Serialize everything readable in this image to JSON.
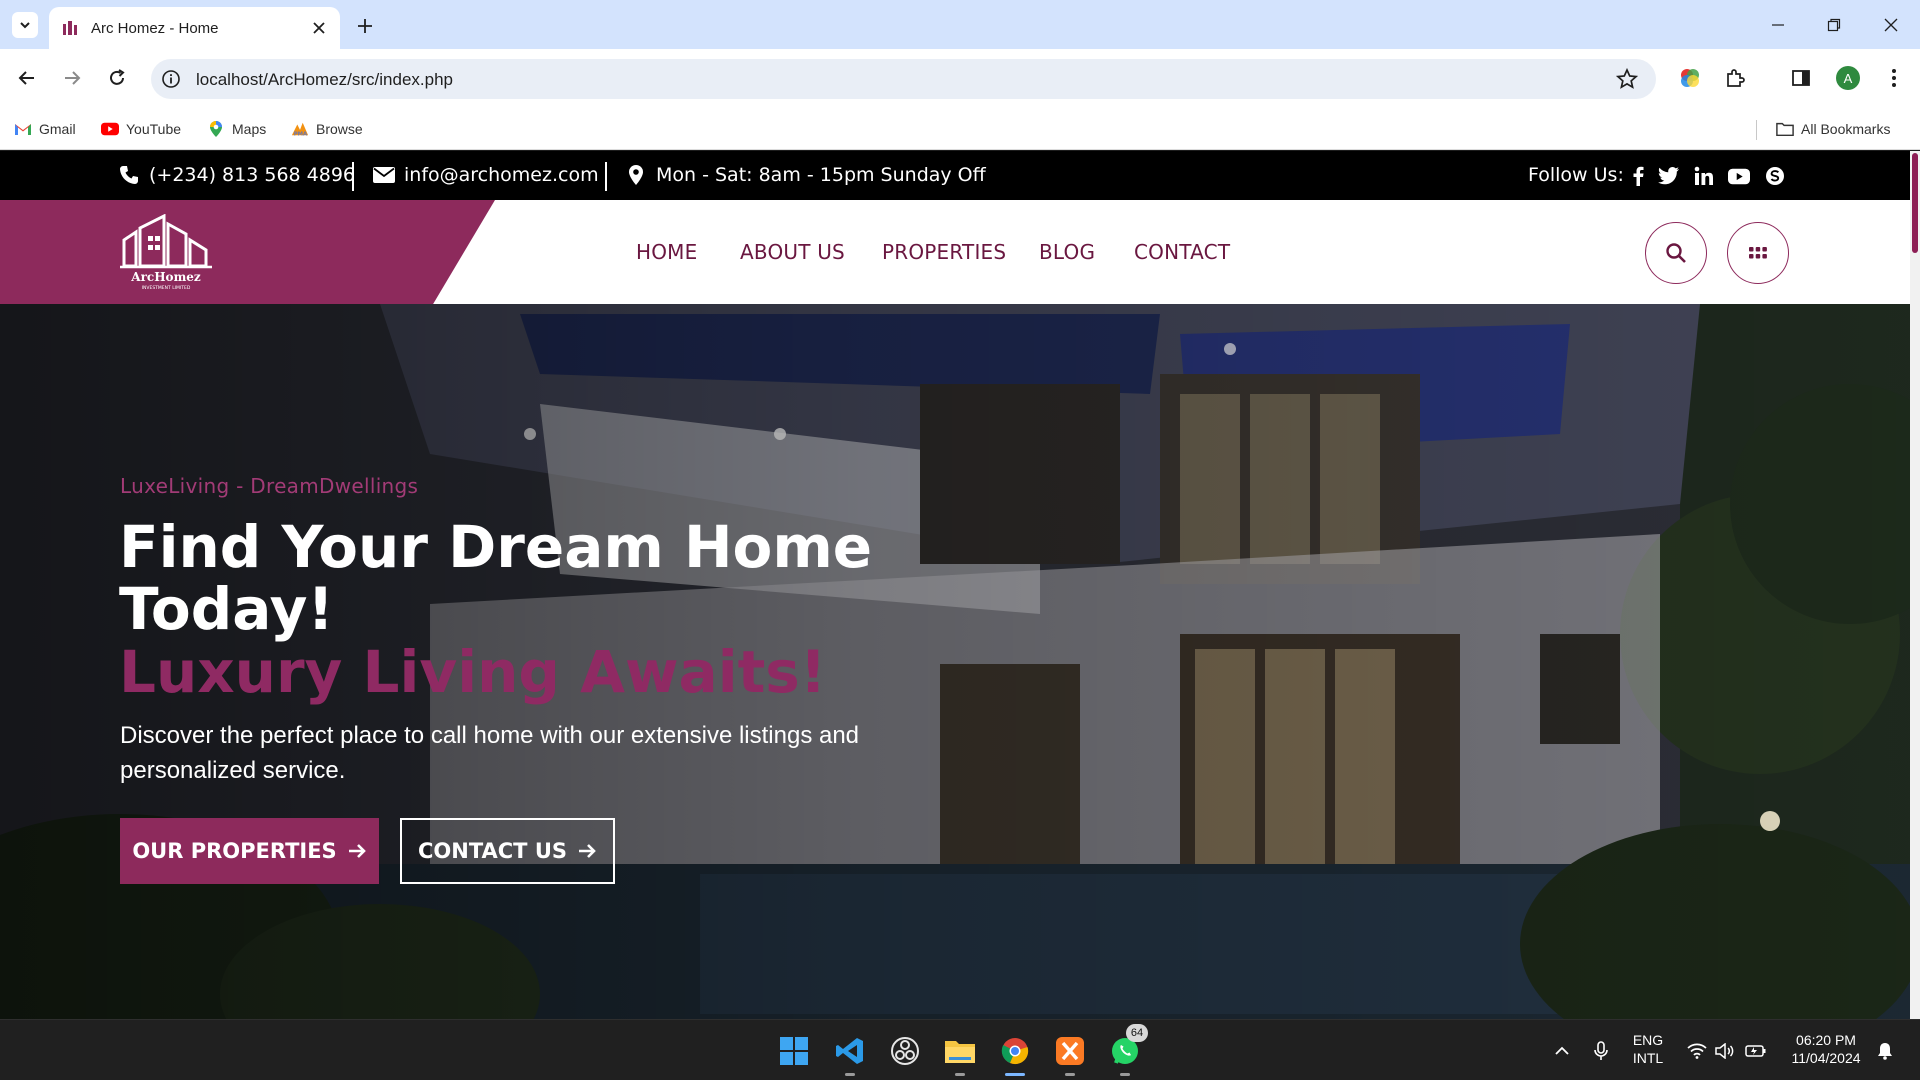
{
  "browser": {
    "tab_title": "Arc Homez - Home",
    "url": "localhost/ArcHomez/src/index.php",
    "profile_initial": "A",
    "bookmarks": [
      {
        "label": "Gmail",
        "icon": "gmail-icon"
      },
      {
        "label": "YouTube",
        "icon": "youtube-icon"
      },
      {
        "label": "Maps",
        "icon": "maps-icon"
      },
      {
        "label": "Browse",
        "icon": "phpmyadmin-icon"
      }
    ],
    "all_bookmarks": "All Bookmarks"
  },
  "topbar": {
    "phone": "(+234) 813 568 4896",
    "email": "info@archomez.com",
    "hours": "Mon - Sat: 8am - 15pm Sunday Off",
    "follow_label": "Follow Us:",
    "socials": [
      "facebook-icon",
      "twitter-icon",
      "linkedin-icon",
      "youtube-icon",
      "skype-icon"
    ]
  },
  "logo": {
    "text": "ArcHomez",
    "tagline": "INVESTMENT LIMITED"
  },
  "nav": {
    "items": [
      "HOME",
      "ABOUT US",
      "PROPERTIES",
      "BLOG",
      "CONTACT"
    ]
  },
  "hero": {
    "eyebrow": "LuxeLiving - DreamDwellings",
    "title_line1": "Find Your Dream Home",
    "title_line2": "Today!",
    "title_accent": "Luxury Living Awaits!",
    "lead": "Discover the perfect place to call home with our extensive listings and personalized service.",
    "btn_primary": "OUR PROPERTIES",
    "btn_secondary": "CONTACT US"
  },
  "taskbar": {
    "whatsapp_badge": "64",
    "lang_top": "ENG",
    "lang_bottom": "INTL",
    "time": "06:20 PM",
    "date": "11/04/2024"
  },
  "colors": {
    "brand": "#8d2a5c",
    "brand_dark": "#6a1740",
    "topbar_bg": "#000000",
    "chrome_tabbar": "#d3e3fd"
  }
}
